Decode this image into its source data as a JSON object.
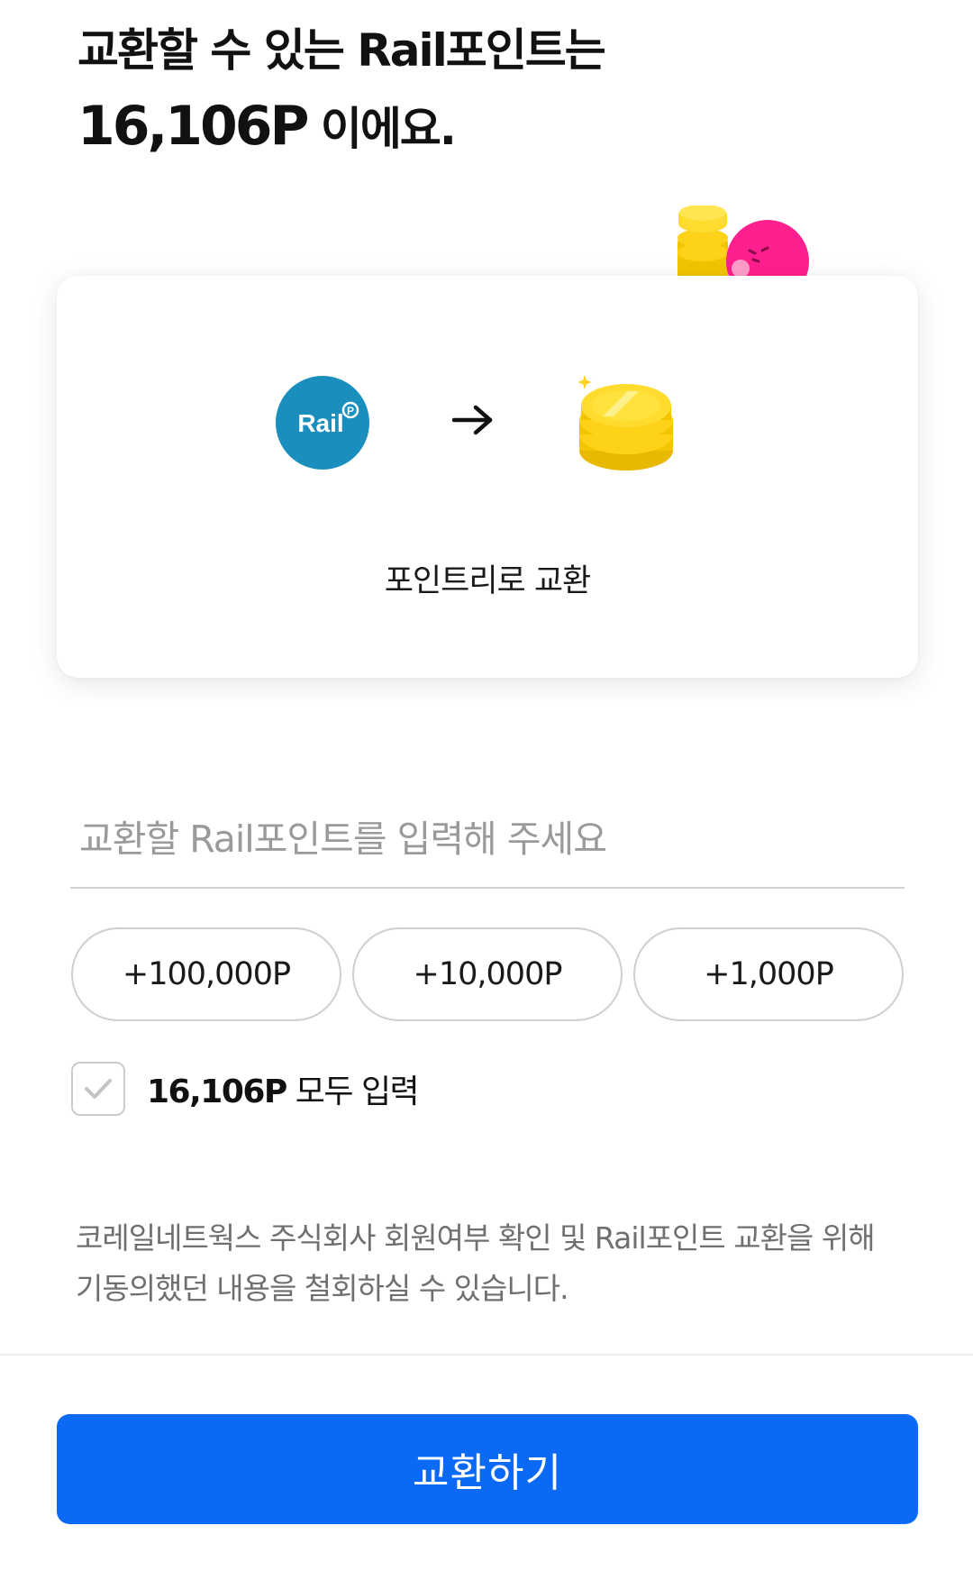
{
  "header": {
    "title_line1": "교환할 수 있는 Rail포인트는",
    "title_amount": "16,106P",
    "title_suffix": " 이에요."
  },
  "card": {
    "from_logo_text": "Rail",
    "from_logo_badge": "P",
    "label": "포인트리로 교환"
  },
  "input": {
    "placeholder": "교환할 Rail포인트를 입력해 주세요",
    "value": ""
  },
  "quick_add": [
    {
      "label": "+100,000P"
    },
    {
      "label": "+10,000P"
    },
    {
      "label": "+1,000P"
    }
  ],
  "use_all": {
    "checked": false,
    "amount": "16,106P",
    "label": " 모두 입력"
  },
  "notice": {
    "text": "코레일네트웍스 주식회사 회원여부 확인 및 Rail포인트 교환을 위해 기동의했던 내용을 철회하실 수 있습니다."
  },
  "primary_button": {
    "label": "교환하기"
  },
  "colors": {
    "primary": "#0a6af5",
    "rail_brand": "#1a8fbd",
    "coin_gold": "#ffd21a",
    "mascot_pink": "#ff1f8e"
  }
}
